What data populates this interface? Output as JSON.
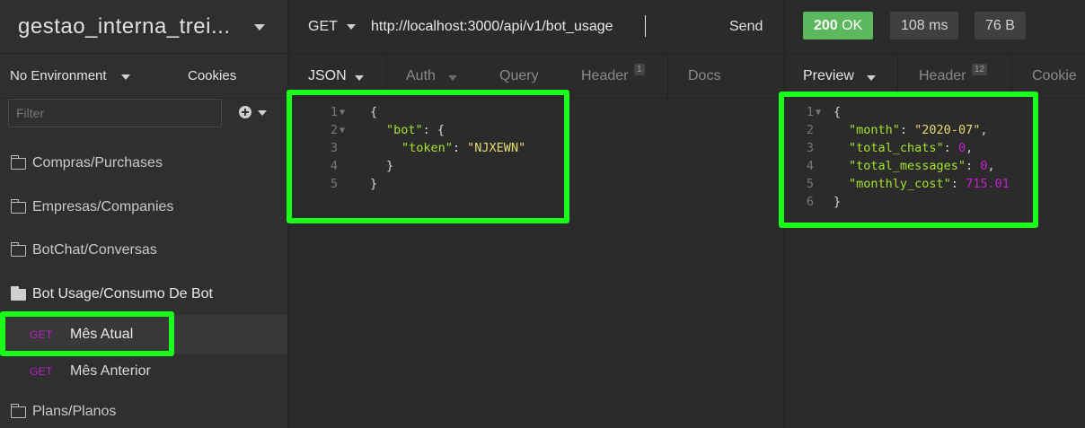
{
  "workspace": {
    "title": "gestao_interna_trei..."
  },
  "environment": {
    "label": "No Environment",
    "cookies_label": "Cookies"
  },
  "filter": {
    "placeholder": "Filter"
  },
  "sidebar": {
    "folders": [
      {
        "label": "Compras/Purchases"
      },
      {
        "label": "Empresas/Companies"
      },
      {
        "label": "BotChat/Conversas"
      },
      {
        "label": "Bot Usage/Consumo De Bot"
      },
      {
        "label": "Plans/Planos"
      }
    ],
    "requests": [
      {
        "method": "GET",
        "name": "Mês Atual"
      },
      {
        "method": "GET",
        "name": "Mês Anterior"
      }
    ]
  },
  "request": {
    "method": "GET",
    "url": "http://localhost:3000/api/v1/bot_usage",
    "send_label": "Send",
    "tabs": [
      {
        "label": "JSON"
      },
      {
        "label": "Auth"
      },
      {
        "label": "Query"
      },
      {
        "label": "Header",
        "badge": "1"
      },
      {
        "label": "Docs"
      }
    ],
    "body_lines": [
      {
        "num": "1",
        "text": "{"
      },
      {
        "num": "2",
        "key": "\"bot\"",
        "rest": ": {"
      },
      {
        "num": "3",
        "key": "\"token\"",
        "sep": ": ",
        "str": "\"NJXEWN\""
      },
      {
        "num": "4",
        "text": "}"
      },
      {
        "num": "5",
        "text": "}"
      }
    ]
  },
  "response": {
    "status": {
      "code": "200",
      "text": "OK"
    },
    "time": "108 ms",
    "size": "76 B",
    "tabs": [
      {
        "label": "Preview"
      },
      {
        "label": "Header",
        "badge": "12"
      },
      {
        "label": "Cookie"
      }
    ],
    "body_lines": [
      {
        "num": "1",
        "text": "{"
      },
      {
        "num": "2",
        "key": "\"month\"",
        "sep": ": ",
        "str": "\"2020-07\"",
        "tail": ","
      },
      {
        "num": "3",
        "key": "\"total_chats\"",
        "sep": ": ",
        "numval": "0",
        "tail": ","
      },
      {
        "num": "4",
        "key": "\"total_messages\"",
        "sep": ": ",
        "numval": "0",
        "tail": ","
      },
      {
        "num": "5",
        "key": "\"monthly_cost\"",
        "sep": ": ",
        "numval": "715.01"
      },
      {
        "num": "6",
        "text": "}"
      }
    ]
  },
  "colors": {
    "highlight": "#1aff1a",
    "status_ok": "#5cb85c",
    "method_get": "#b81ec8",
    "json_key": "#a6e22e",
    "json_string": "#e6db74",
    "json_number": "#c71fd2"
  }
}
